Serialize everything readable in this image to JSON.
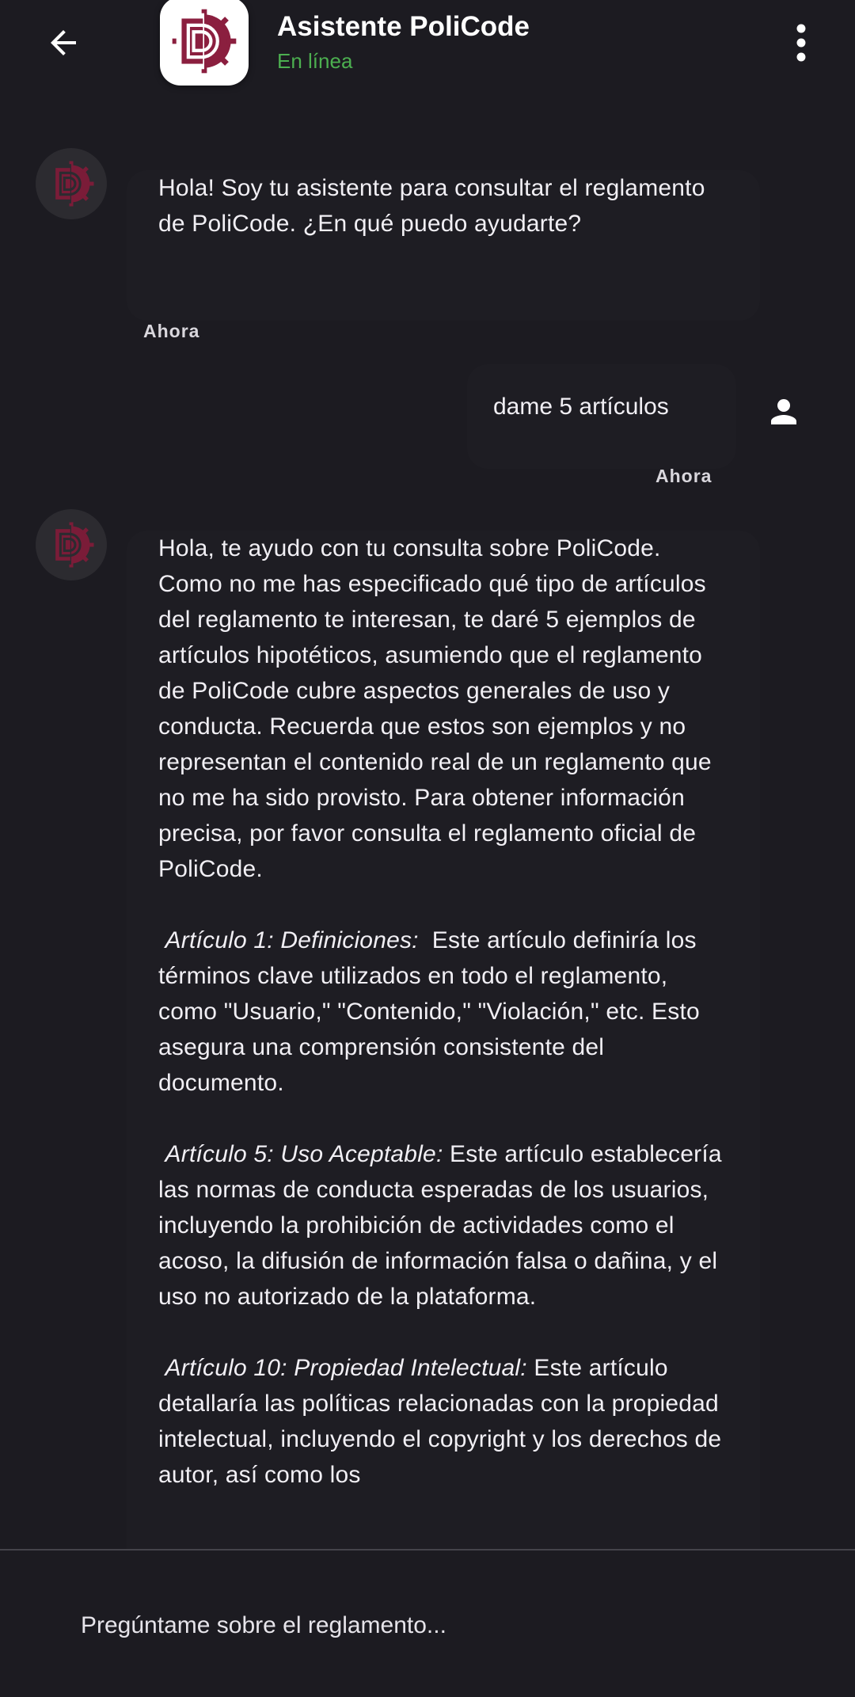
{
  "app": {
    "title": "Asistente PoliCode",
    "status": "En línea",
    "colors": {
      "background": "#1c1b21",
      "bubble": "#1e1d23",
      "status_online": "#4caf50",
      "brand": "#8b1f3f"
    }
  },
  "header": {
    "back_icon": "arrow-left-icon",
    "menu_icon": "more-vert-icon",
    "logo_icon": "policode-logo-icon"
  },
  "messages": [
    {
      "sender": "bot",
      "text": "Hola! Soy tu asistente para consultar el reglamento de PoliCode. ¿En qué puedo ayudarte?",
      "time": "Ahora"
    },
    {
      "sender": "user",
      "text": "dame 5 artículos",
      "time": "Ahora",
      "icon": "person-icon"
    },
    {
      "sender": "bot",
      "intro": "Hola, te ayudo con tu consulta sobre PoliCode. Como no me has especificado qué tipo de artículos del reglamento te interesan, te daré 5 ejemplos de artículos hipotéticos, asumiendo que el reglamento de PoliCode cubre aspectos generales de uso y conducta.  Recuerda que estos son ejemplos y no representan el contenido real de un reglamento que no me ha sido provisto.  Para obtener información precisa, por favor consulta el reglamento oficial de PoliCode.",
      "articles": [
        {
          "title": "Artículo 1: Definiciones:",
          "body": "Este artículo definiría los términos clave utilizados en todo el reglamento, como \"Usuario,\" \"Contenido,\" \"Violación,\" etc.  Esto asegura una comprensión consistente del documento."
        },
        {
          "title": "Artículo 5: Uso Aceptable:",
          "body": "Este artículo establecería las normas de conducta esperadas de los usuarios, incluyendo la prohibición de actividades como el acoso, la difusión de información falsa o dañina, y el uso no autorizado de la plataforma."
        },
        {
          "title": "Artículo 10: Propiedad Intelectual:",
          "body": "Este artículo detallaría las políticas relacionadas con la propiedad intelectual, incluyendo el copyright y los derechos de autor, así como los"
        }
      ]
    }
  ],
  "input": {
    "placeholder": "Pregúntame sobre el reglamento..."
  }
}
